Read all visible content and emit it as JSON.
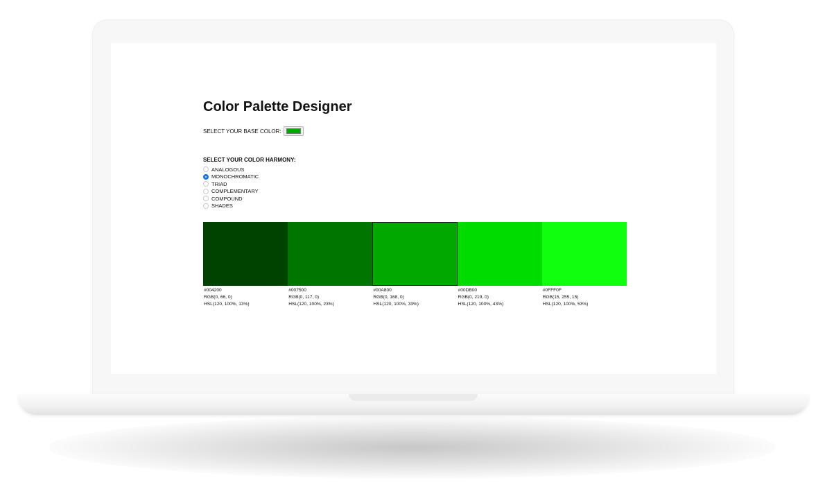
{
  "app": {
    "title": "Color Palette Designer",
    "base_color_label": "SELECT YOUR BASE COLOR:",
    "base_color_value": "#00A800",
    "harmony_label": "SELECT YOUR COLOR HARMONY:",
    "harmony_options": [
      {
        "label": "ANALOGOUS",
        "checked": false
      },
      {
        "label": "MONOCHROMATIC",
        "checked": true
      },
      {
        "label": "TRIAD",
        "checked": false
      },
      {
        "label": "COMPLEMENTARY",
        "checked": false
      },
      {
        "label": "COMPOUND",
        "checked": false
      },
      {
        "label": "SHADES",
        "checked": false
      }
    ],
    "swatches": [
      {
        "hex": "#004200",
        "rgb": "RGB(0, 66, 0)",
        "hsl": "HSL(120, 100%, 13%)",
        "selected": false
      },
      {
        "hex": "#007500",
        "rgb": "RGB(0, 117, 0)",
        "hsl": "HSL(120, 100%, 23%)",
        "selected": false
      },
      {
        "hex": "#00A800",
        "rgb": "RGB(0, 168, 0)",
        "hsl": "HSL(120, 100%, 33%)",
        "selected": true
      },
      {
        "hex": "#00DB00",
        "rgb": "RGB(0, 219, 0)",
        "hsl": "HSL(120, 100%, 43%)",
        "selected": false
      },
      {
        "hex": "#0FFF0F",
        "rgb": "RGB(15, 255, 15)",
        "hsl": "HSL(120, 100%, 53%)",
        "selected": false
      }
    ]
  }
}
